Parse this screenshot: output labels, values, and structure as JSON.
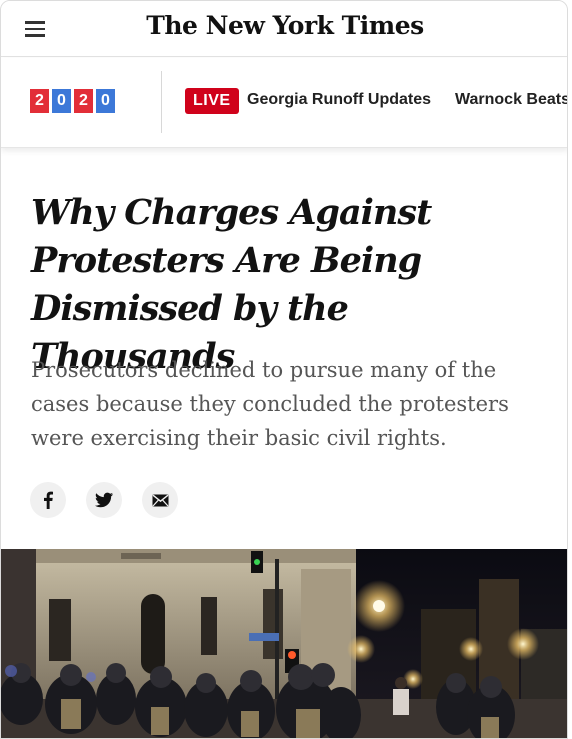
{
  "masthead": {
    "logo_text": "The New York Times",
    "menu_icon": "hamburger-menu-icon"
  },
  "strip": {
    "year_digits": [
      "2",
      "0",
      "2",
      "0"
    ],
    "live_label": "LIVE",
    "links": [
      "Georgia Runoff Updates",
      "Warnock Beats"
    ]
  },
  "article": {
    "headline": "Why Charges Against Protesters Are Being Dismissed by the Thousands",
    "summary": "Prosecutors declined to pursue many of the cases because they concluded the protesters were exercising their basic civil rights."
  },
  "share": {
    "icons": [
      "facebook-icon",
      "twitter-icon",
      "email-icon"
    ]
  },
  "colors": {
    "year_red": "#e22e38",
    "year_blue": "#3c78d8",
    "live_red": "#d0021b"
  }
}
